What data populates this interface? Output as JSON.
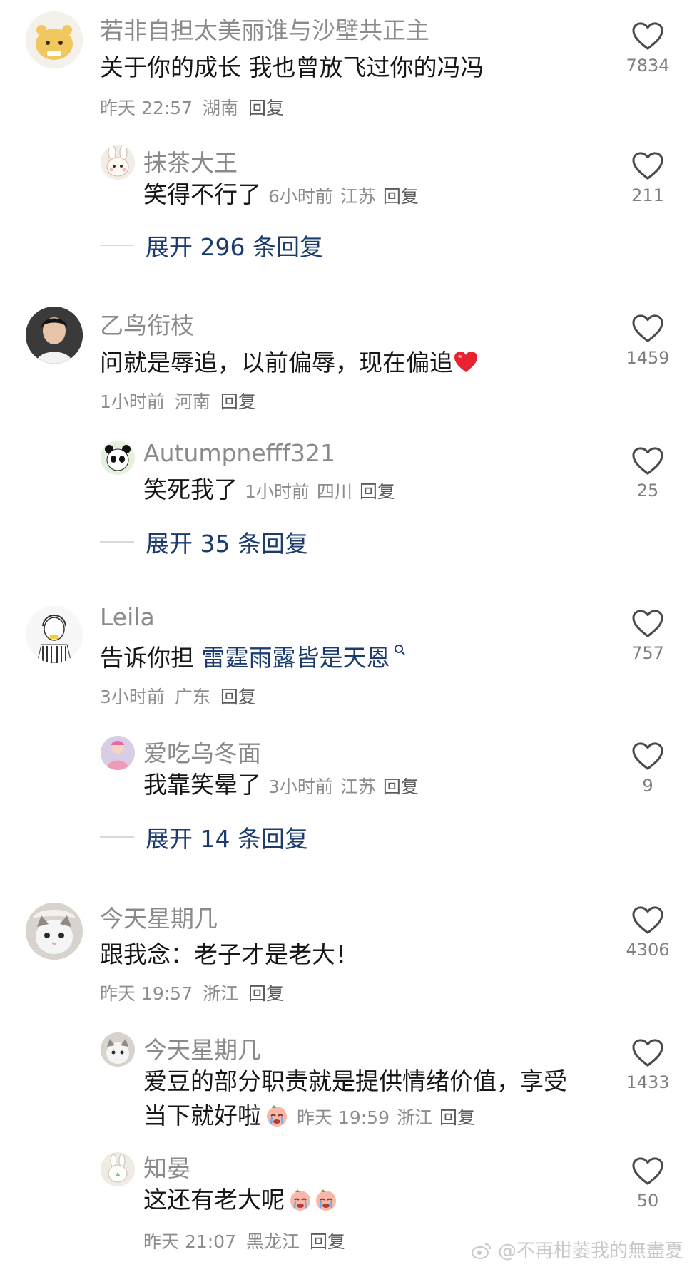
{
  "comments": [
    {
      "user": "若非自担太美丽谁与沙壁共正主",
      "text": "关于你的成长 我也曾放飞过你的冯冯",
      "time": "昨天 22:57",
      "location": "湖南",
      "reply_label": "回复",
      "likes": "7834",
      "sub": {
        "user": "抹茶大王",
        "text": "笑得不行了",
        "time": "6小时前",
        "location": "江苏",
        "reply_label": "回复",
        "likes": "211"
      },
      "expand_label": "展开 296 条回复"
    },
    {
      "user": "乙鸟衔枝",
      "text": "问就是辱追，以前偏辱，现在偏追",
      "time": "1小时前",
      "location": "河南",
      "reply_label": "回复",
      "likes": "1459",
      "sub": {
        "user": "Autumpnefff321",
        "text": "笑死我了",
        "time": "1小时前",
        "location": "四川",
        "reply_label": "回复",
        "likes": "25"
      },
      "expand_label": "展开 35 条回复"
    },
    {
      "user": "Leila",
      "text": "告诉你担",
      "link_text": "雷霆雨露皆是天恩",
      "time": "3小时前",
      "location": "广东",
      "reply_label": "回复",
      "likes": "757",
      "sub": {
        "user": "爱吃乌冬面",
        "text": "我靠笑晕了",
        "time": "3小时前",
        "location": "江苏",
        "reply_label": "回复",
        "likes": "9"
      },
      "expand_label": "展开 14 条回复"
    },
    {
      "user": "今天星期几",
      "text": "跟我念：老子才是老大！",
      "time": "昨天 19:57",
      "location": "浙江",
      "reply_label": "回复",
      "likes": "4306",
      "sub": {
        "user": "今天星期几",
        "text_line1": "爱豆的部分职责就是提供情绪价值，享受",
        "text_line2": "当下就好啦",
        "time": "昨天 19:59",
        "location": "浙江",
        "reply_label": "回复",
        "likes": "1433"
      },
      "sub2": {
        "user": "知晏",
        "text": "这还有老大呢",
        "time": "昨天 21:07",
        "location": "黑龙江",
        "reply_label": "回复",
        "likes": "50"
      }
    }
  ],
  "watermark": "@不再柑萎我的無盡夏",
  "colors": {
    "link": "#1d3c6e",
    "heart_red": "#e8232f",
    "meta": "#8d8d8d"
  },
  "icons": [
    "heart-outline-icon",
    "red-heart-emoji",
    "crying-emoji",
    "search-link-icon",
    "weibo-logo-icon"
  ]
}
